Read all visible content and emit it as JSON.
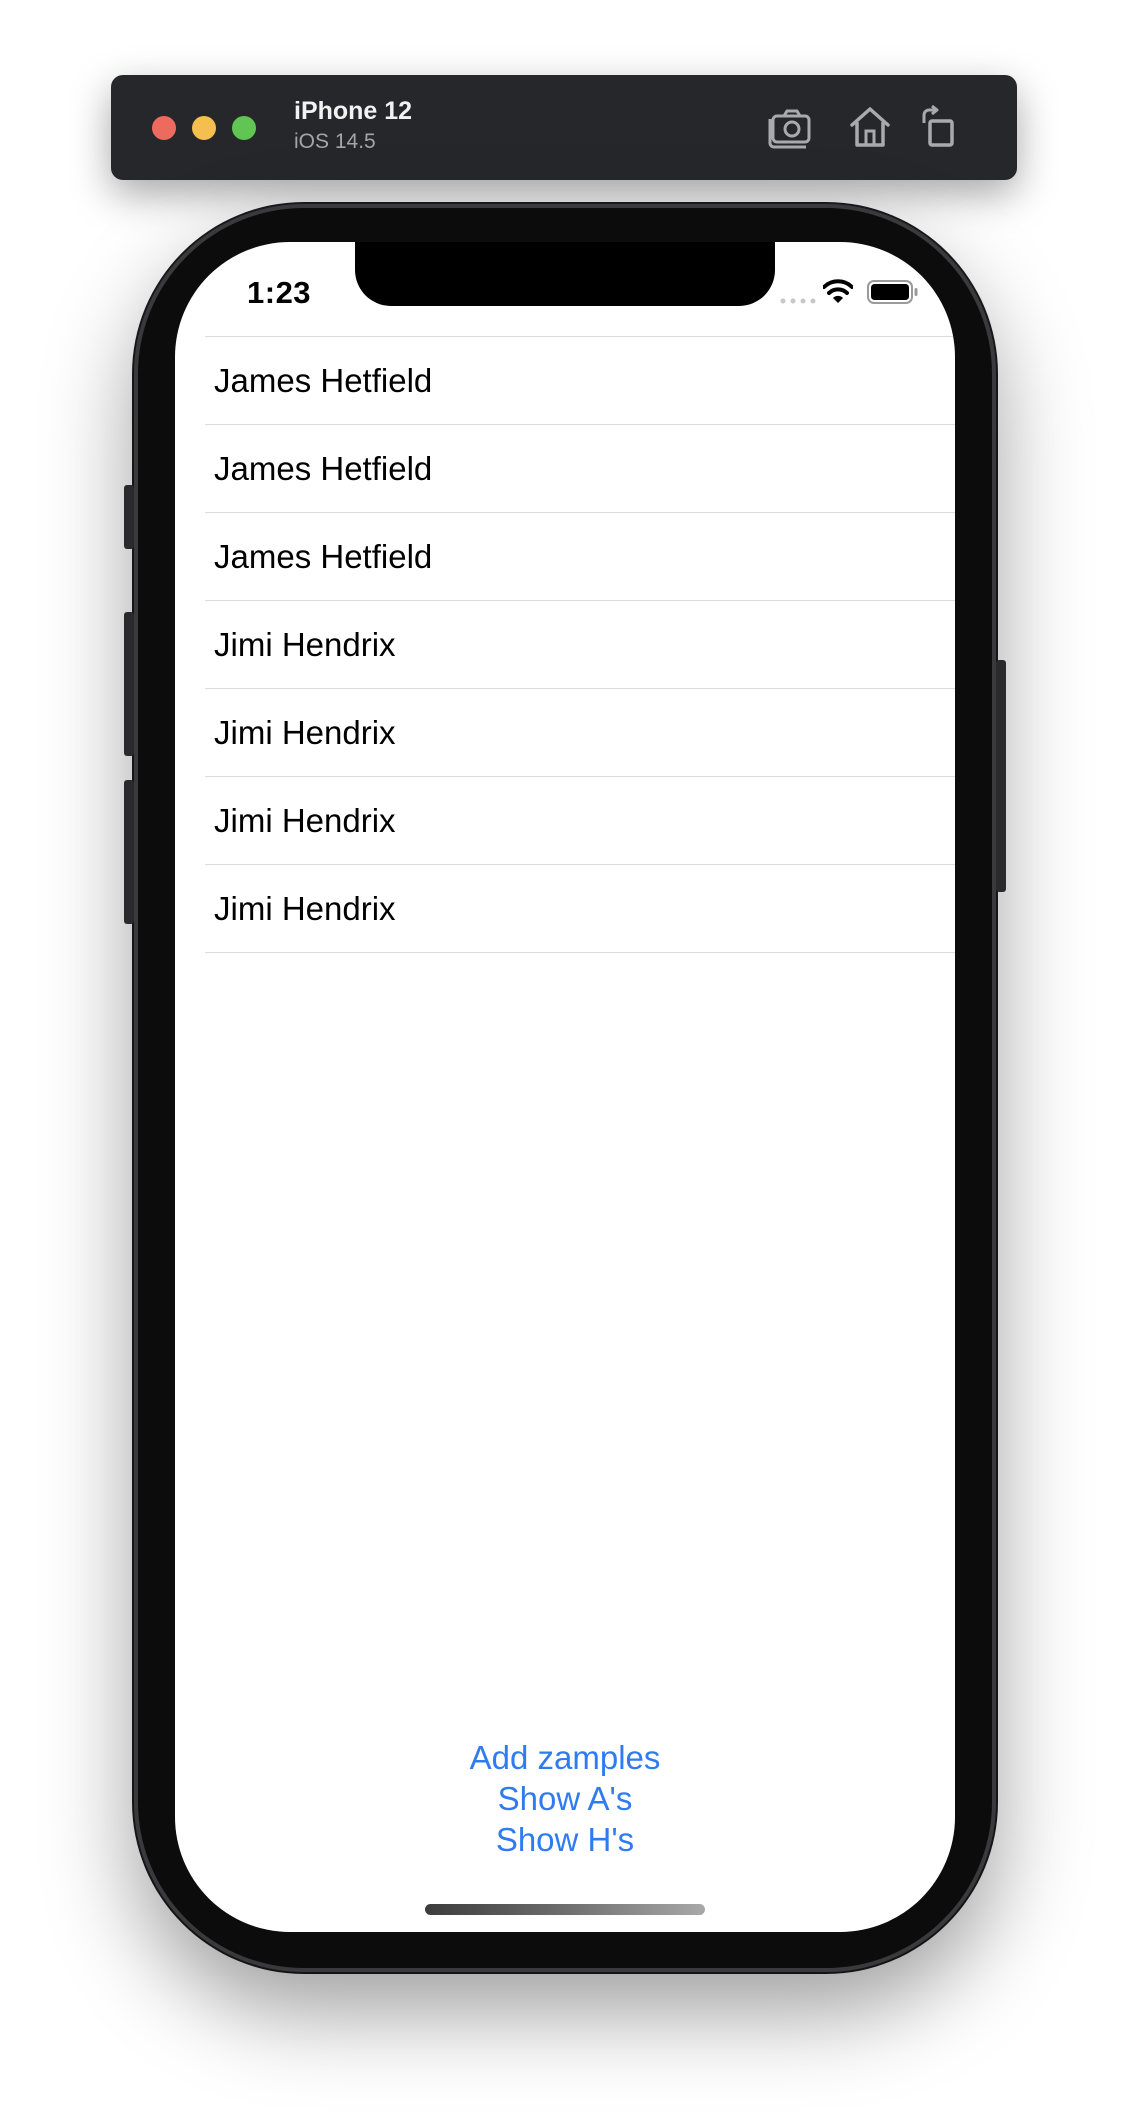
{
  "simulator": {
    "device_name": "iPhone 12",
    "os_version": "iOS 14.5",
    "toolbar_icons": [
      "screenshot-icon",
      "home-icon",
      "rotate-icon"
    ]
  },
  "status_bar": {
    "time": "1:23",
    "icons": [
      "cellular-signal-icon",
      "wifi-icon",
      "battery-icon"
    ]
  },
  "list": {
    "rows": [
      {
        "label": "James Hetfield"
      },
      {
        "label": "James Hetfield"
      },
      {
        "label": "James Hetfield"
      },
      {
        "label": "Jimi Hendrix"
      },
      {
        "label": "Jimi Hendrix"
      },
      {
        "label": "Jimi Hendrix"
      },
      {
        "label": "Jimi Hendrix"
      }
    ]
  },
  "actions": {
    "add_samples": "Add zamples",
    "show_a": "Show A's",
    "show_h": "Show H's"
  },
  "colors": {
    "accent": "#2f7bf0",
    "toolbar_bg": "#25272b",
    "traffic_red": "#ec6a5e",
    "traffic_yellow": "#f4bf4f",
    "traffic_green": "#61c554"
  }
}
